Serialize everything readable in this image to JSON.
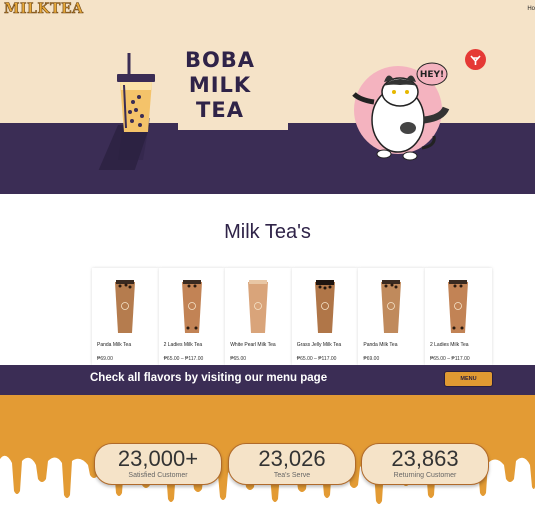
{
  "header": {
    "logo": "MILKTEA",
    "nav_home": "Ho"
  },
  "hero": {
    "title_lines": [
      "BOBA",
      "MILK",
      "TEA"
    ],
    "speech_bubble": "HEY!",
    "badge_icon": "shop-badge-icon",
    "colors": {
      "cream": "#f5e3c8",
      "purple": "#3b2d55",
      "pink": "#f4b3bf"
    }
  },
  "section": {
    "title": "Milk Tea's"
  },
  "products": [
    {
      "name": "Panda Milk Tea",
      "price": "₱69.00",
      "style": "panda"
    },
    {
      "name": "2 Ladies Milk Tea",
      "price": "₱65.00 – ₱117.00",
      "style": "ladies"
    },
    {
      "name": "White Pearl Milk Tea",
      "price": "₱65.00",
      "style": "white"
    },
    {
      "name": "Grass Jelly Milk Tea",
      "price": "₱65.00 – ₱117.00",
      "style": "jelly"
    },
    {
      "name": "Panda Milk Tea",
      "price": "₱69.00",
      "style": "panda"
    },
    {
      "name": "2 Ladies Milk Tea",
      "price": "₱65.00 – ₱117.00",
      "style": "ladies"
    }
  ],
  "menu_band": {
    "text": "Check all flavors by visiting our menu page",
    "button": "MENU"
  },
  "stats": [
    {
      "number": "23,000+",
      "label": "Satisfied Customer"
    },
    {
      "number": "23,026",
      "label": "Tea's Serve"
    },
    {
      "number": "23,863",
      "label": "Returning Customer"
    }
  ]
}
